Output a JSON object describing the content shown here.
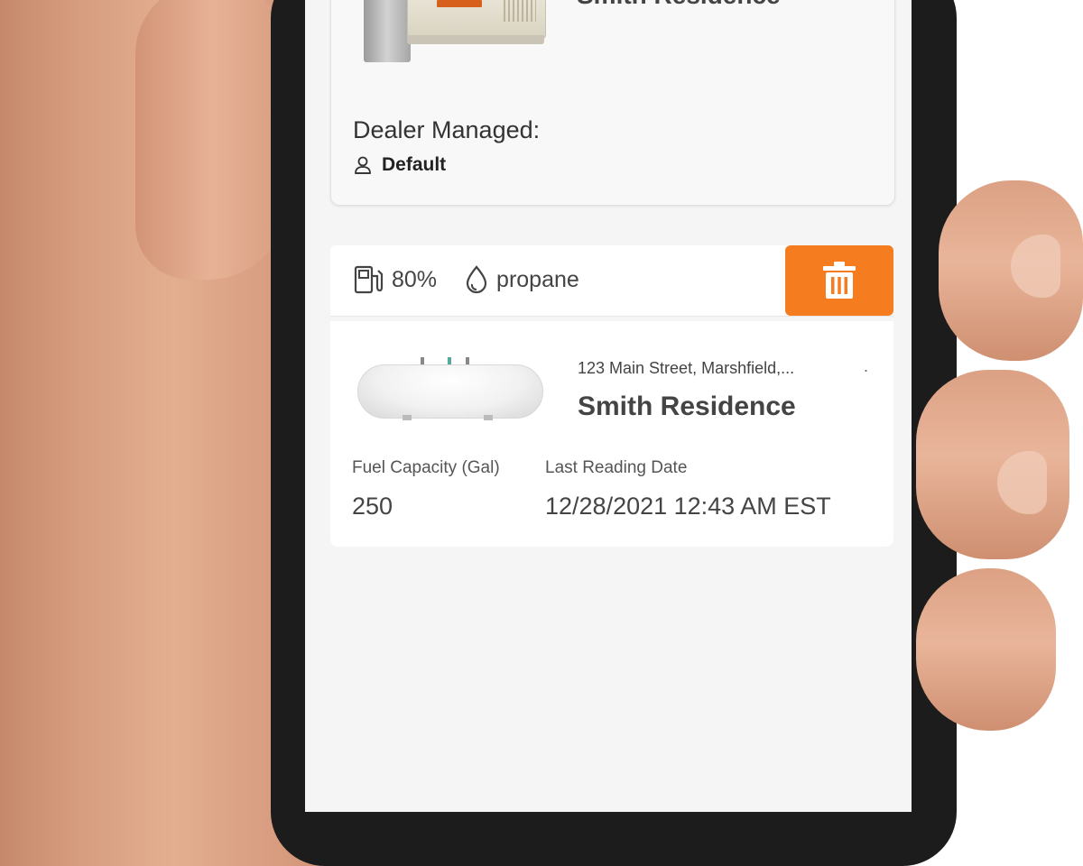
{
  "card_generator": {
    "title": "Smith Residence",
    "dealer_label": "Dealer Managed:",
    "dealer_value": "Default"
  },
  "tank_bar": {
    "fuel_level": "80%",
    "fuel_type": "propane",
    "delete_icon": "trash-icon",
    "accent_color": "#f57c1f"
  },
  "card_tank": {
    "address": "123 Main Street, Marshfield,...",
    "address_trailing": ".",
    "title": "Smith Residence",
    "capacity_label": "Fuel Capacity (Gal)",
    "capacity_value": "250",
    "reading_label": "Last Reading Date",
    "reading_value": "12/28/2021 12:43 AM EST"
  }
}
